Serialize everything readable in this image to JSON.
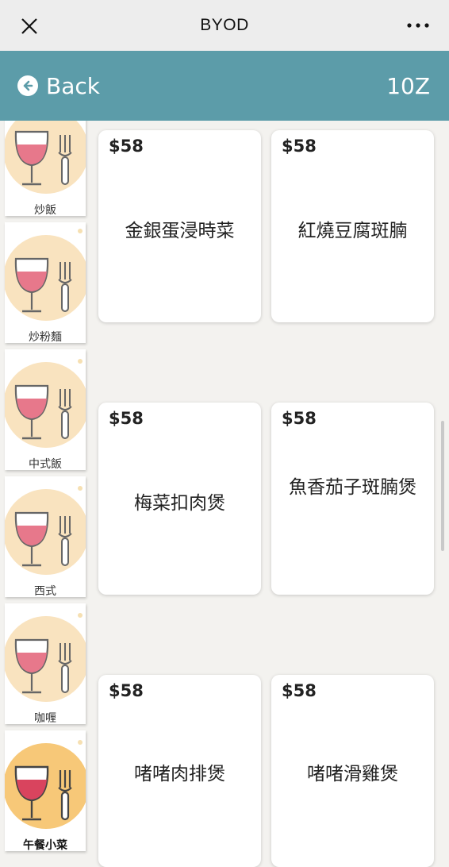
{
  "topbar": {
    "title": "BYOD"
  },
  "header": {
    "back_label": "Back",
    "table": "10Z"
  },
  "categories": [
    {
      "label": "炒飯"
    },
    {
      "label": "炒粉麵"
    },
    {
      "label": "中式飯"
    },
    {
      "label": "西式"
    },
    {
      "label": "咖喱"
    },
    {
      "label": "午餐小菜",
      "active": true
    }
  ],
  "items": [
    {
      "price": "$58",
      "name": "金銀蛋浸時菜"
    },
    {
      "price": "$58",
      "name": "紅燒豆腐斑腩"
    },
    {
      "price": "$58",
      "name": "梅菜扣肉煲"
    },
    {
      "price": "$58",
      "name": "魚香茄子斑腩煲"
    },
    {
      "price": "$58",
      "name": "啫啫肉排煲"
    },
    {
      "price": "$58",
      "name": "啫啫滑雞煲"
    }
  ],
  "icons": {
    "category": "wine-glass-and-fork-icon",
    "back": "arrow-left-circle-icon",
    "close": "close-icon",
    "more": "more-dots-icon"
  },
  "colors": {
    "header": "#5c9ca9",
    "wine": "#e7788b",
    "blob": "#f9e3bf"
  }
}
